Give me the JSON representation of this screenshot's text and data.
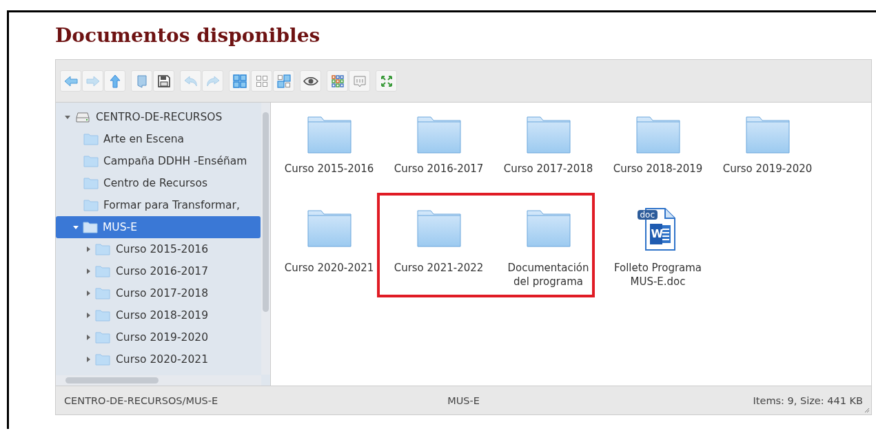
{
  "heading": "Documentos disponibles",
  "toolbar": [
    [
      {
        "kind": "back",
        "disabled": false
      },
      {
        "kind": "forward",
        "disabled": true
      },
      {
        "kind": "up",
        "disabled": false
      }
    ],
    [
      {
        "kind": "open",
        "disabled": false
      },
      {
        "kind": "save",
        "disabled": false
      }
    ],
    [
      {
        "kind": "undo",
        "disabled": true
      },
      {
        "kind": "redo",
        "disabled": true
      }
    ],
    [
      {
        "kind": "large",
        "disabled": false
      },
      {
        "kind": "small",
        "disabled": false
      },
      {
        "kind": "mixed",
        "disabled": false
      }
    ],
    [
      {
        "kind": "preview",
        "disabled": false
      }
    ],
    [
      {
        "kind": "colors",
        "disabled": false
      },
      {
        "kind": "sort",
        "disabled": false
      }
    ],
    [
      {
        "kind": "fullscreen",
        "disabled": false
      }
    ]
  ],
  "tree": {
    "label": "CENTRO-DE-RECURSOS",
    "expanded": true,
    "children": [
      {
        "label": "Arte en Escena",
        "selected": false
      },
      {
        "label": "Campaña DDHH -Enséñam",
        "selected": false
      },
      {
        "label": "Centro de Recursos",
        "selected": false
      },
      {
        "label": "Formar para Transformar,",
        "selected": false
      },
      {
        "label": "MUS-E",
        "selected": true,
        "expanded": true,
        "children": [
          {
            "label": "Curso 2015-2016",
            "expanded": false
          },
          {
            "label": "Curso 2016-2017",
            "expanded": false
          },
          {
            "label": "Curso 2017-2018",
            "expanded": false
          },
          {
            "label": "Curso 2018-2019",
            "expanded": false
          },
          {
            "label": "Curso 2019-2020",
            "expanded": false
          },
          {
            "label": "Curso 2020-2021",
            "expanded": false
          }
        ]
      }
    ]
  },
  "files": [
    {
      "kind": "folder",
      "name": "Curso 2015-2016"
    },
    {
      "kind": "folder",
      "name": "Curso 2016-2017"
    },
    {
      "kind": "folder",
      "name": "Curso 2017-2018"
    },
    {
      "kind": "folder",
      "name": "Curso 2018-2019"
    },
    {
      "kind": "folder",
      "name": "Curso 2019-2020"
    },
    {
      "kind": "folder",
      "name": "Curso 2020-2021"
    },
    {
      "kind": "folder",
      "name": "Curso 2021-2022"
    },
    {
      "kind": "folder",
      "name": "Documentación del programa"
    },
    {
      "kind": "word",
      "name": "Folleto Programa MUS-E.doc",
      "badge": "doc",
      "glyph": "W"
    }
  ],
  "status_bar": {
    "path": "CENTRO-DE-RECURSOS/MUS-E",
    "folder": "MUS-E",
    "summary": "Items: 9, Size: 441 KB"
  }
}
